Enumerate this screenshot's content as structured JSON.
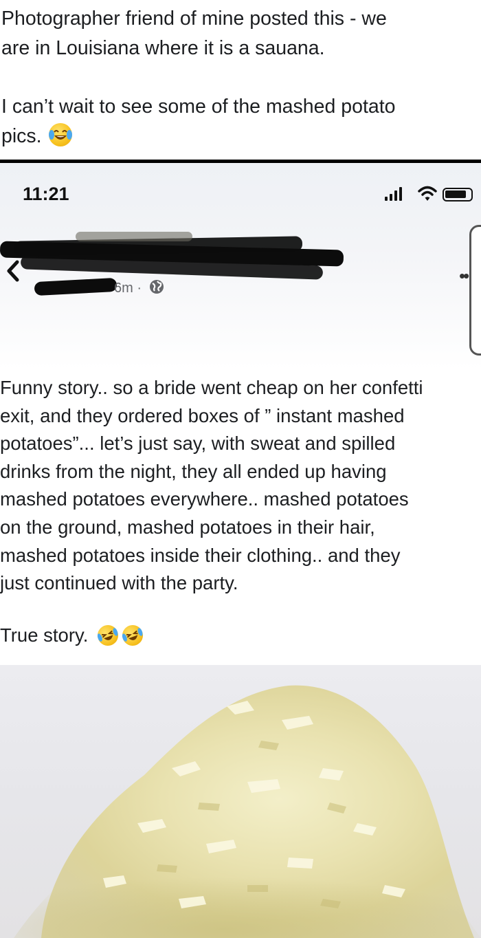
{
  "top_post": {
    "line1": "Photographer friend of mine posted this - we",
    "line2": "are in Louisiana where it is a sauana.",
    "line3": "I can’t wait to see some of the mashed potato",
    "line4": "pics.",
    "emoji": "tears-of-joy-emoji"
  },
  "status_bar": {
    "time": "11:21",
    "icons": [
      "signal-icon",
      "wifi-icon",
      "battery-icon"
    ]
  },
  "post_header": {
    "author": "[redacted]",
    "timestamp": "6m ·",
    "audience_icon": "globe-icon",
    "more_icon": "more-dots-icon",
    "back_icon": "chevron-left-icon"
  },
  "post_body": {
    "lines": [
      "Funny story.. so a bride went cheap on her confetti",
      "exit, and they ordered boxes of ” instant mashed",
      "potatoes”... let’s just say, with sweat and spilled",
      "drinks from the night, they all ended up having",
      "mashed potatoes everywhere.. mashed potatoes",
      "on the ground, mashed potatoes in their hair,",
      "mashed potatoes inside their clothing.. and they",
      "just continued with the party."
    ],
    "closing": "True story.",
    "closing_emojis": [
      "rolling-laughing-emoji",
      "rolling-laughing-emoji"
    ]
  },
  "photo": {
    "subject": "instant-mashed-potato-flakes-photo"
  },
  "colors": {
    "text": "#1c1e21",
    "secondary_text": "#65676b",
    "divider": "#000000"
  }
}
